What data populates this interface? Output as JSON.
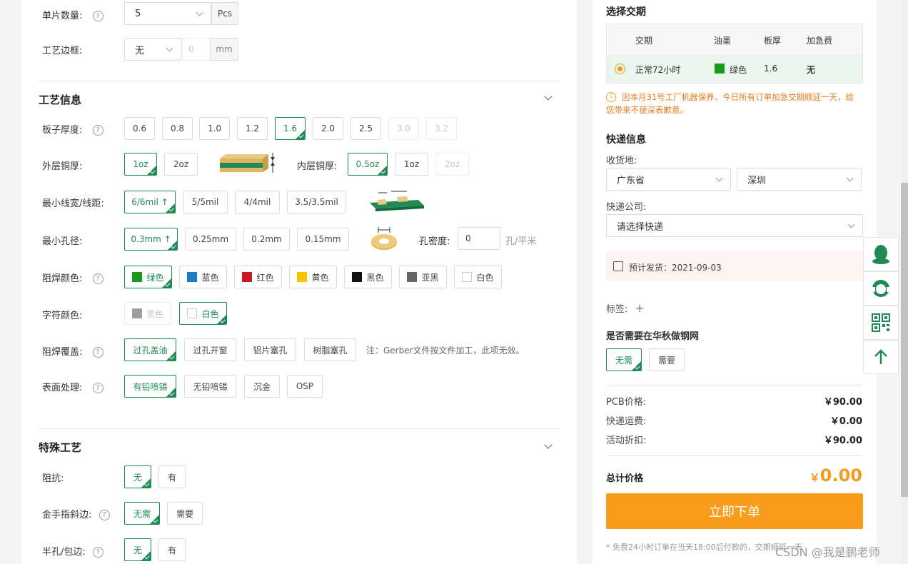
{
  "left": {
    "qty": {
      "label": "单片数量:",
      "value": "5",
      "unit": "Pcs"
    },
    "frame": {
      "label": "工艺边框:",
      "value": "无",
      "num": "0",
      "unit": "mm"
    },
    "section1": "工艺信息",
    "thickness": {
      "label": "板子厚度:",
      "options": [
        "0.6",
        "0.8",
        "1.0",
        "1.2",
        "1.6",
        "2.0",
        "2.5",
        "3.0",
        "3.2"
      ]
    },
    "outer_cu": {
      "label": "外层铜厚:",
      "options": [
        "1oz",
        "2oz"
      ]
    },
    "inner_cu": {
      "label": "内层铜厚:",
      "options": [
        "0.5oz",
        "1oz",
        "2oz"
      ]
    },
    "trace": {
      "label": "最小线宽/线距:",
      "options": [
        "6/6mil ↑",
        "5/5mil",
        "4/4mil",
        "3.5/3.5mil"
      ]
    },
    "hole": {
      "label": "最小孔径:",
      "options": [
        "0.3mm ↑",
        "0.25mm",
        "0.2mm",
        "0.15mm"
      ],
      "density_label": "孔密度:",
      "density_value": "0",
      "density_unit": "孔/平米"
    },
    "mask": {
      "label": "阻焊颜色:",
      "options": [
        "绿色",
        "蓝色",
        "红色",
        "黄色",
        "黑色",
        "亚黑",
        "白色"
      ],
      "colors": [
        "#1a9a1a",
        "#1a7fc9",
        "#c8191e",
        "#f5c400",
        "#111111",
        "#666666",
        "#ffffff"
      ]
    },
    "silk": {
      "label": "字符颜色:",
      "options": [
        "黑色",
        "白色"
      ],
      "colors": [
        "#9e9e9e",
        "#ffffff"
      ]
    },
    "cover": {
      "label": "阻焊覆盖:",
      "options": [
        "过孔盖油",
        "过孔开窗",
        "铝片塞孔",
        "树脂塞孔"
      ],
      "note": "注：Gerber文件按文件加工，此项无效。"
    },
    "surface": {
      "label": "表面处理:",
      "options": [
        "有铅喷锡",
        "无铅喷锡",
        "沉金",
        "OSP"
      ]
    },
    "section2": "特殊工艺",
    "impedance": {
      "label": "阻抗:",
      "options": [
        "无",
        "有"
      ]
    },
    "gold": {
      "label": "金手指斜边:",
      "options": [
        "无需",
        "需要"
      ]
    },
    "half": {
      "label": "半孔/包边:",
      "options": [
        "无",
        "有"
      ]
    }
  },
  "right": {
    "delivery_title": "选择交期",
    "table_headers": [
      "交期",
      "油墨",
      "板厚",
      "加急费"
    ],
    "table_row": {
      "period": "正常72小时",
      "ink": "绿色",
      "thick": "1.6",
      "fee": "无"
    },
    "notice": "因本月31号工厂机器保养，今日所有订单加急交期顺延一天，给您带来不便深表歉意。",
    "express_title": "快递信息",
    "addr_label": "收货地:",
    "province": "广东省",
    "city": "深圳",
    "company_label": "快递公司:",
    "company_placeholder": "请选择快递",
    "ship_date": "预计发货：2021-09-03",
    "tag_label": "标签:",
    "stencil_q": "是否需要在华秋做钢网",
    "stencil_options": [
      "无需",
      "需要"
    ],
    "pcb_label": "PCB价格:",
    "pcb_value": "￥90.00",
    "ship_label": "快递运费:",
    "ship_value": "￥0.00",
    "disc_label": "活动折扣:",
    "disc_value": "￥90.00",
    "total_label": "总计价格",
    "total_currency": "￥",
    "total_value": "0.00",
    "order_btn": "立即下单",
    "footnote": "* 免费24小时订单在当天18:00后付款的，交期顺延一天"
  },
  "watermark": "CSDN @我是鹏老师"
}
